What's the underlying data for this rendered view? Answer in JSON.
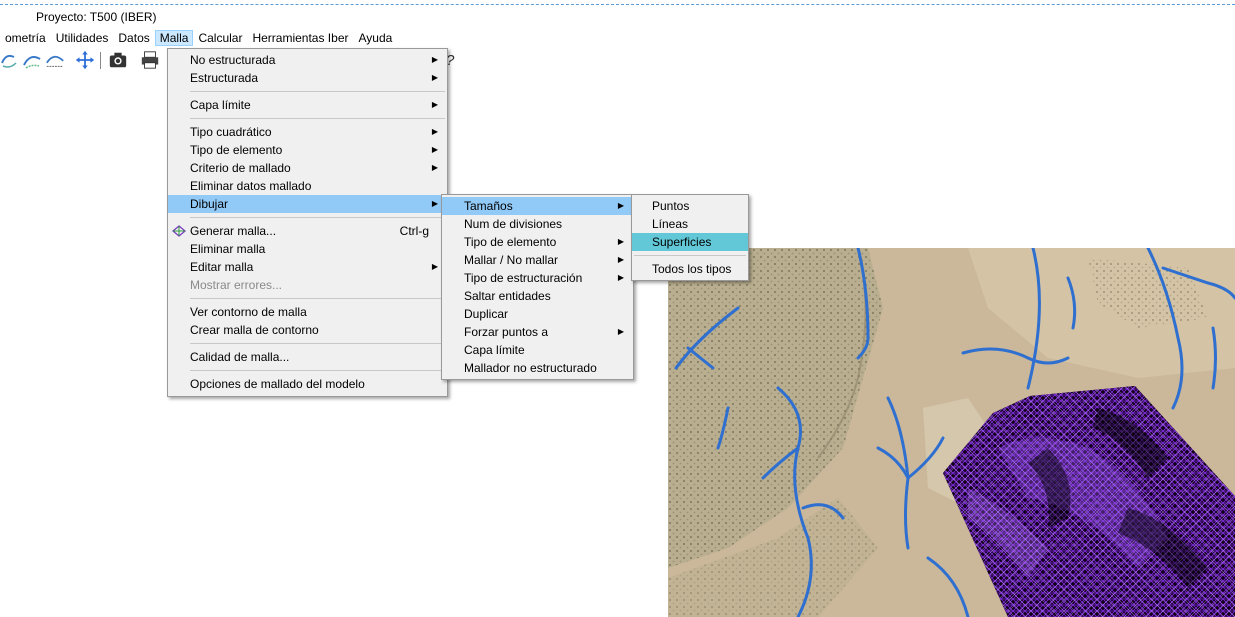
{
  "window": {
    "title": "Proyecto: T500 (IBER)"
  },
  "menubar": {
    "items": [
      {
        "label": "ometría",
        "active": false
      },
      {
        "label": "Utilidades",
        "active": false
      },
      {
        "label": "Datos",
        "active": false
      },
      {
        "label": "Malla",
        "active": true
      },
      {
        "label": "Calcular",
        "active": false
      },
      {
        "label": "Herramientas Iber",
        "active": false
      },
      {
        "label": "Ayuda",
        "active": false
      }
    ]
  },
  "toolbar": {
    "icons": [
      "rotate-icon",
      "pan-view-icon",
      "move-icon",
      "camera-icon",
      "print-icon",
      "help-icon"
    ],
    "help_glyph": "?"
  },
  "malla_menu": {
    "items": [
      {
        "label": "No estructurada",
        "submenu": true
      },
      {
        "label": "Estructurada",
        "submenu": true
      },
      {
        "label": "Capa límite",
        "submenu": true
      },
      {
        "label": "Tipo cuadrático",
        "submenu": true
      },
      {
        "label": "Tipo de elemento",
        "submenu": true
      },
      {
        "label": "Criterio de mallado",
        "submenu": true
      },
      {
        "label": "Eliminar datos mallado"
      },
      {
        "label": "Dibujar",
        "submenu": true,
        "highlighted": true
      },
      {
        "label": "Generar malla...",
        "shortcut": "Ctrl-g",
        "icon": "mesh-generate-icon"
      },
      {
        "label": "Eliminar malla"
      },
      {
        "label": "Editar malla",
        "submenu": true
      },
      {
        "label": "Mostrar errores...",
        "disabled": true
      },
      {
        "label": "Ver contorno de malla"
      },
      {
        "label": "Crear malla de contorno"
      },
      {
        "label": "Calidad de malla..."
      },
      {
        "label": "Opciones de mallado del modelo"
      }
    ]
  },
  "dibujar_menu": {
    "items": [
      {
        "label": "Tamaños",
        "submenu": true,
        "highlighted": true
      },
      {
        "label": "Num de divisiones"
      },
      {
        "label": "Tipo de elemento",
        "submenu": true
      },
      {
        "label": "Mallar / No mallar",
        "submenu": true
      },
      {
        "label": "Tipo de estructuración",
        "submenu": true
      },
      {
        "label": "Saltar entidades"
      },
      {
        "label": "Duplicar"
      },
      {
        "label": "Forzar puntos a",
        "submenu": true
      },
      {
        "label": "Capa límite"
      },
      {
        "label": "Mallador no estructurado"
      }
    ]
  },
  "tamanos_menu": {
    "items": [
      {
        "label": "Puntos"
      },
      {
        "label": "Líneas"
      },
      {
        "label": "Superficies",
        "highlighted": true
      },
      {
        "label": "Todos los tipos"
      }
    ]
  },
  "colors": {
    "menu_bg": "#f0f0f0",
    "menu_highlight": "#91c9f7",
    "submenu_highlight": "#62c8d8",
    "river": "#2e6fd0",
    "mesh_bg": "#0d0010",
    "mesh_color": "#8a2be2",
    "terrain": "#c9b79a"
  }
}
